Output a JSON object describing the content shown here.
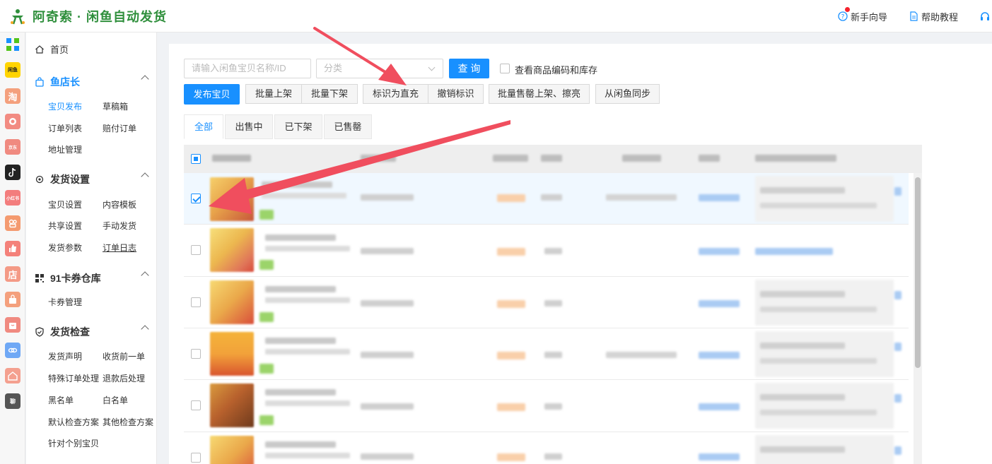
{
  "app": {
    "title": "阿奇索 · 闲鱼自动发货",
    "brand_color": "#2f8f3c",
    "accent_color": "#1890ff"
  },
  "header": {
    "guide": "新手向导",
    "help": "帮助教程"
  },
  "rail": {
    "items": [
      {
        "icon": "grid-app-icon",
        "label": ""
      },
      {
        "icon": "xianyu-badge-icon",
        "label": "闲鱼"
      },
      {
        "icon": "taobao-icon",
        "label": "淘"
      },
      {
        "icon": "pinduoduo-icon",
        "label": ""
      },
      {
        "icon": "jd-icon",
        "label": "京东"
      },
      {
        "icon": "douyin-icon",
        "label": ""
      },
      {
        "icon": "xiaohongshu-icon",
        "label": "小红书"
      },
      {
        "icon": "kuaishou-icon",
        "label": ""
      },
      {
        "icon": "thumb-up-icon",
        "label": ""
      },
      {
        "icon": "store-icon",
        "label": "店"
      },
      {
        "icon": "bag-icon",
        "label": ""
      },
      {
        "icon": "shop-bag-icon",
        "label": ""
      },
      {
        "icon": "link-icon",
        "label": ""
      },
      {
        "icon": "house-icon",
        "label": ""
      },
      {
        "icon": "chat-icon",
        "label": "聊"
      }
    ]
  },
  "sidebar": {
    "home": "首页",
    "sections": [
      {
        "title": "鱼店长",
        "items": [
          "宝贝发布",
          "草稿箱",
          "订单列表",
          "赔付订单",
          "地址管理"
        ]
      },
      {
        "title": "发货设置",
        "items": [
          "宝贝设置",
          "内容模板",
          "共享设置",
          "手动发货",
          "发货参数",
          "订单日志"
        ]
      },
      {
        "title": "91卡券仓库",
        "items": [
          "卡券管理"
        ]
      },
      {
        "title": "发货检查",
        "items": [
          "发货声明",
          "收货前一单",
          "特殊订单处理",
          "退款后处理",
          "黑名单",
          "白名单",
          "默认检查方案",
          "其他检查方案",
          "针对个别宝贝"
        ]
      }
    ]
  },
  "toolbar": {
    "search_placeholder": "请输入闲鱼宝贝名称/ID",
    "category_placeholder": "分类",
    "query": "查 询",
    "show_code_stock": "查看商品编码和库存",
    "publish": "发布宝贝",
    "batch_on": "批量上架",
    "batch_off": "批量下架",
    "mark_direct": "标识为直充",
    "unmark": "撤销标识",
    "batch_soldout_on": "批量售罄上架、擦亮",
    "sync": "从闲鱼同步"
  },
  "tabs": [
    "全部",
    "出售中",
    "已下架",
    "已售罄"
  ]
}
